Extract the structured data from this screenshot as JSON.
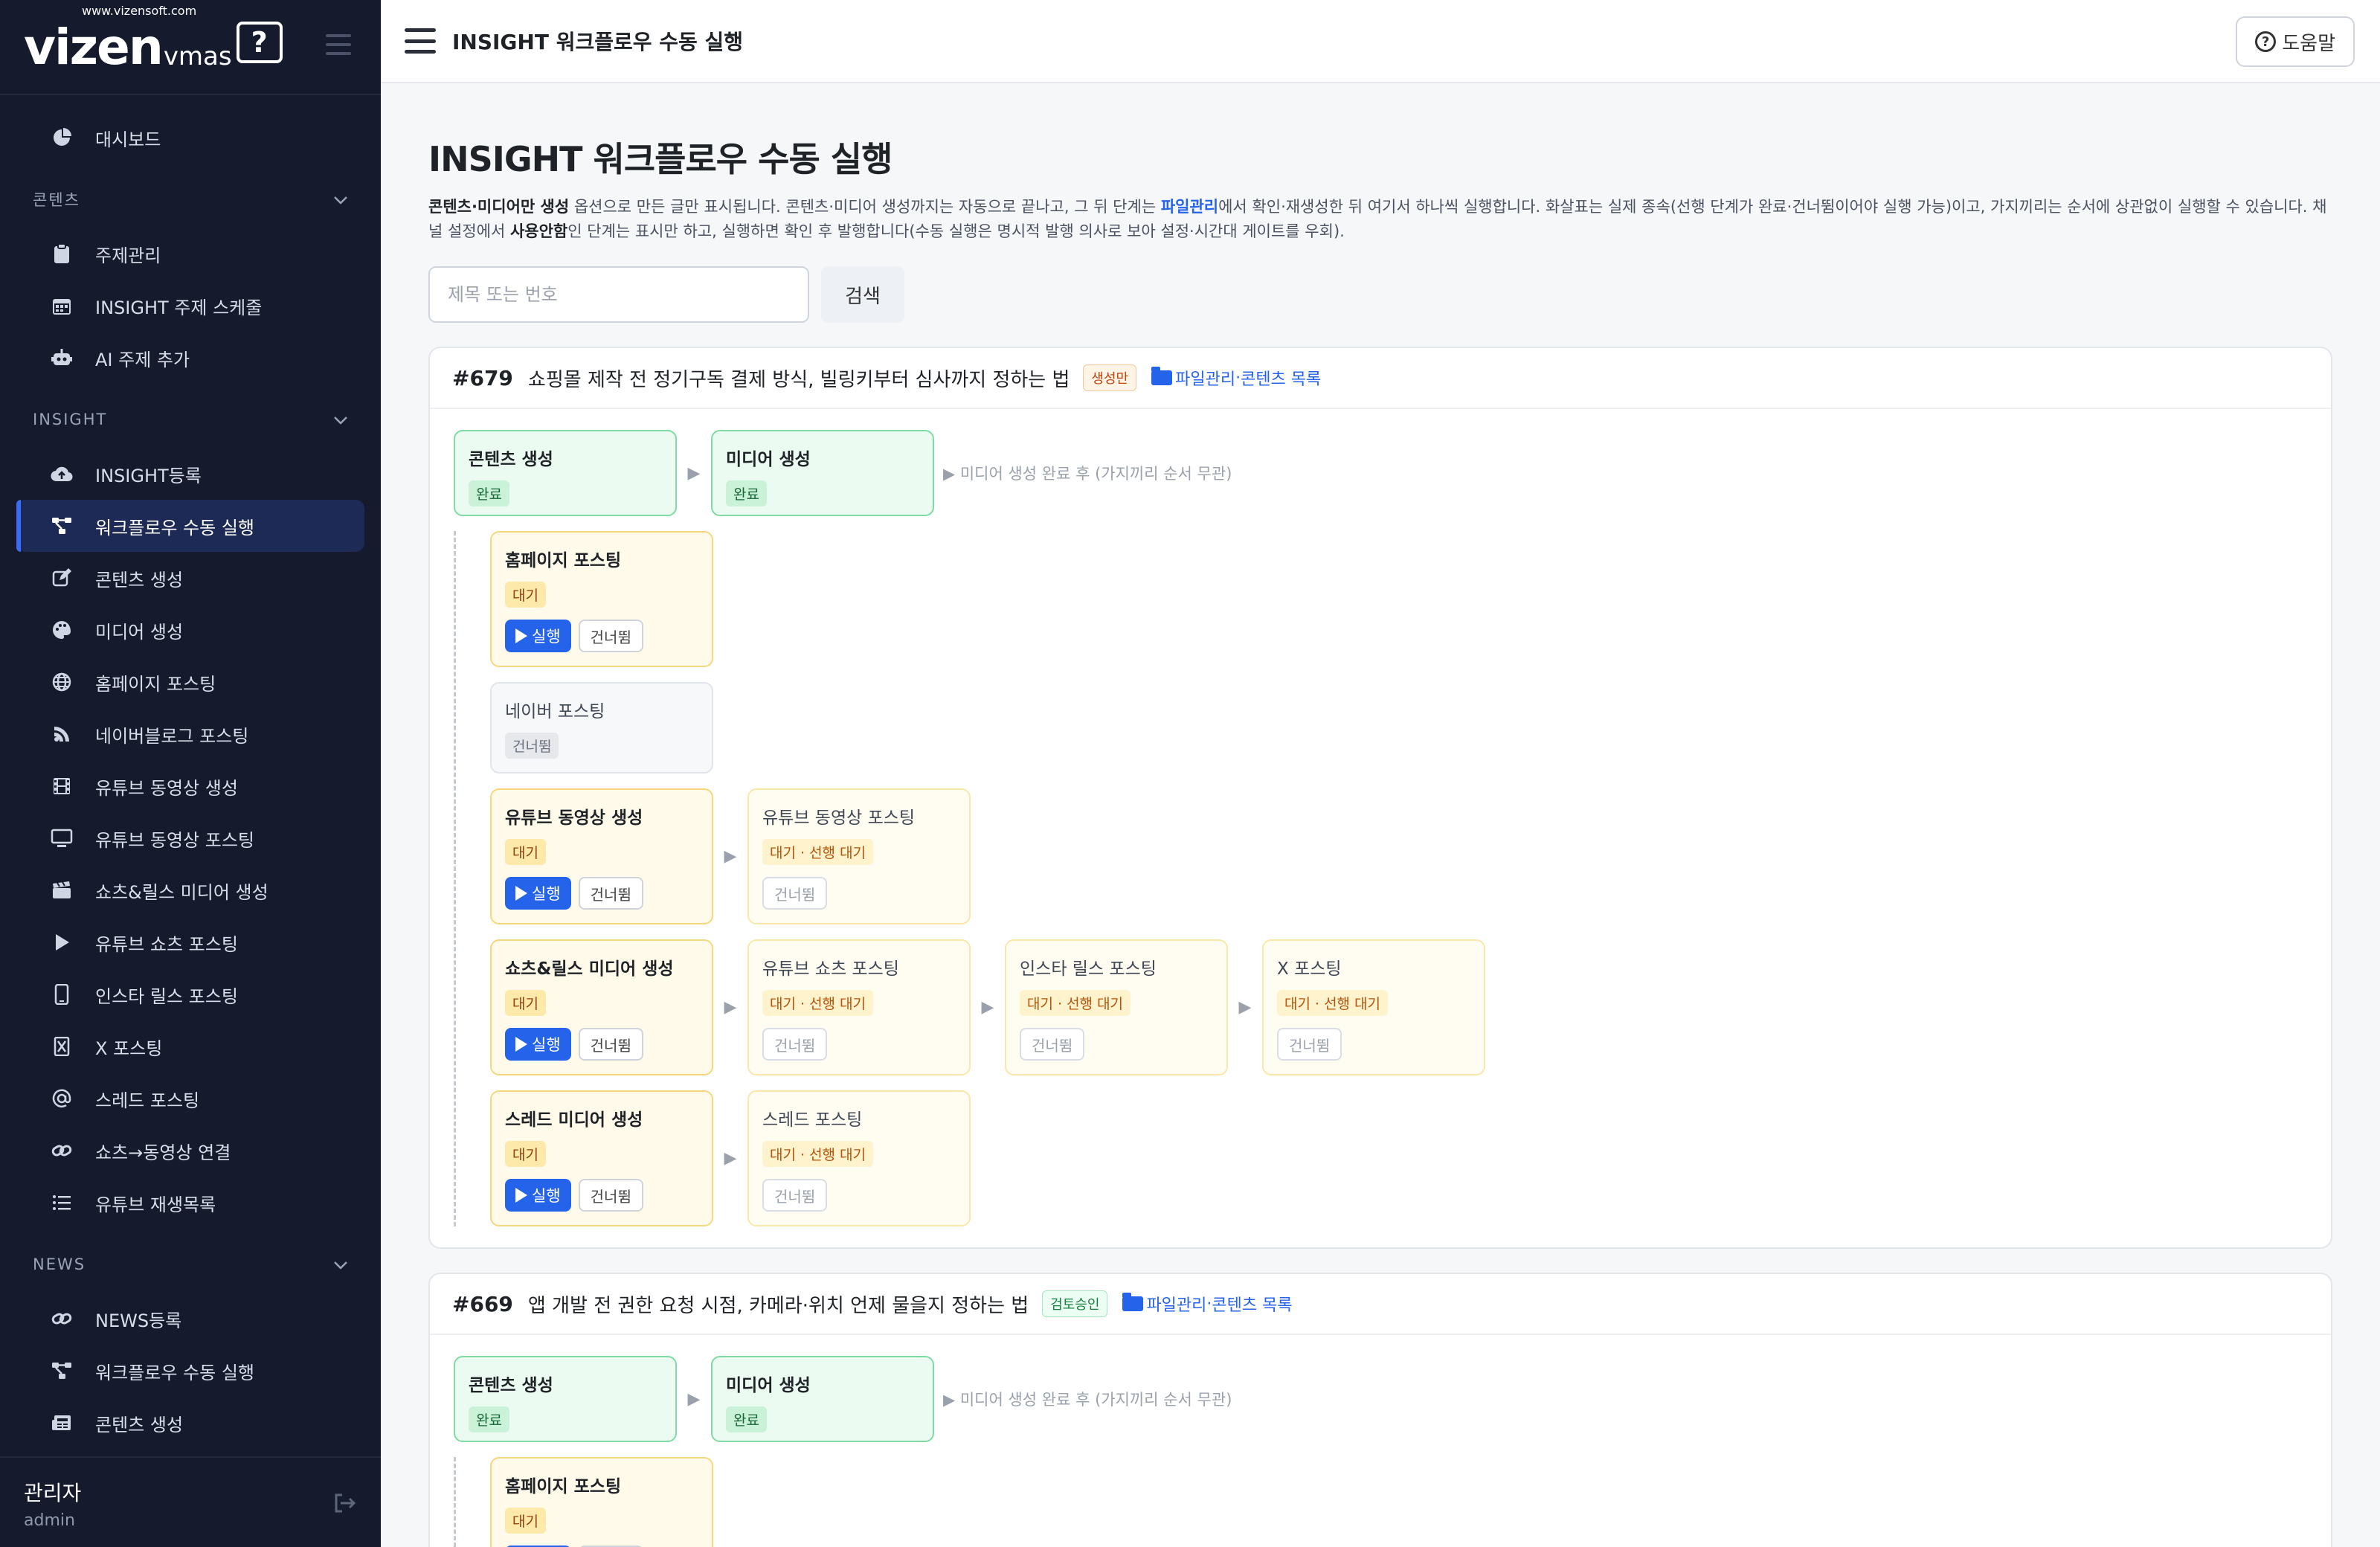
{
  "sidebar": {
    "logo_main": "vizen",
    "logo_sub": "vmas",
    "logo_url": "www.vizensoft.com",
    "logo_mark": "?",
    "top_items": [
      {
        "label": "대시보드",
        "icon": "pie-chart-icon"
      }
    ],
    "sections": [
      {
        "label": "콘텐츠",
        "items": [
          {
            "label": "주제관리",
            "icon": "clipboard-icon"
          },
          {
            "label": "INSIGHT 주제 스케줄",
            "icon": "calendar-icon"
          },
          {
            "label": "AI 주제 추가",
            "icon": "robot-icon"
          }
        ]
      },
      {
        "label": "INSIGHT",
        "items": [
          {
            "label": "INSIGHT등록",
            "icon": "cloud-upload-icon"
          },
          {
            "label": "워크플로우 수동 실행",
            "icon": "workflow-icon"
          },
          {
            "label": "콘텐츠 생성",
            "icon": "edit-icon"
          },
          {
            "label": "미디어 생성",
            "icon": "palette-icon"
          },
          {
            "label": "홈페이지 포스팅",
            "icon": "globe-icon"
          },
          {
            "label": "네이버블로그 포스팅",
            "icon": "blog-icon"
          },
          {
            "label": "유튜브 동영상 생성",
            "icon": "film-icon"
          },
          {
            "label": "유튜브 동영상 포스팅",
            "icon": "monitor-icon"
          },
          {
            "label": "쇼츠&릴스 미디어 생성",
            "icon": "clapper-icon"
          },
          {
            "label": "유튜브 쇼츠 포스팅",
            "icon": "play-icon"
          },
          {
            "label": "인스타 릴스 포스팅",
            "icon": "phone-icon"
          },
          {
            "label": "X 포스팅",
            "icon": "x-icon"
          },
          {
            "label": "스레드 포스팅",
            "icon": "at-icon"
          },
          {
            "label": "쇼츠→동영상 연결",
            "icon": "link-icon"
          },
          {
            "label": "유튜브 재생목록",
            "icon": "list-icon"
          }
        ]
      },
      {
        "label": "NEWS",
        "items": [
          {
            "label": "NEWS등록",
            "icon": "link-icon"
          },
          {
            "label": "워크플로우 수동 실행",
            "icon": "workflow-icon"
          },
          {
            "label": "콘텐츠 생성",
            "icon": "newspaper-icon"
          }
        ]
      }
    ],
    "user": {
      "name": "관리자",
      "role": "admin"
    }
  },
  "topbar": {
    "title": "INSIGHT 워크플로우 수동 실행",
    "help_label": "도움말"
  },
  "page": {
    "title": "INSIGHT 워크플로우 수동 실행",
    "desc_parts": [
      "콘텐츠·미디어만 생성",
      " 옵션으로 만든 글만 표시됩니다. 콘텐츠·미디어 생성까지는 자동으로 끝나고, 그 뒤 단계는 ",
      "파일관리",
      "에서 확인·재생성한 뒤 여기서 하나씩 실행합니다. 화살표는 실제 종속(선행 단계가 완료·건너뜀이어야 실행 가능)이고, 가지끼리는 순서에 상관없이 실행할 수 있습니다. 채널 설정에서 ",
      "사용안함",
      "인 단계는 표시만 하고, 실행하면 확인 후 발행합니다(수동 실행은 명시적 발행 의사로 보아 설정·시간대 게이트를 우회)."
    ],
    "search_placeholder": "제목 또는 번호",
    "search_button": "검색"
  },
  "labels": {
    "run": "실행",
    "skip": "건너뜀",
    "links_a": "파일관리",
    "links_sep": " · ",
    "links_b": "콘텐츠 목록",
    "arrow": "▶",
    "media_note": "▶ 미디어 생성 완료 후 (가지끼리 순서 무관)"
  },
  "cards": [
    {
      "num": "#679",
      "title": "쇼핑몰 제작 전 정기구독 결제 방식, 빌링키부터 심사까지 정하는 법",
      "badge": "생성만",
      "badge_color": "orange",
      "base": [
        {
          "title": "콘텐츠 생성",
          "status": "완료"
        },
        {
          "title": "미디어 생성",
          "status": "완료"
        }
      ],
      "branches": [
        [
          {
            "title": "홈페이지 포스팅",
            "status": "대기",
            "kind": "wait"
          }
        ],
        [
          {
            "title": "네이버 포스팅",
            "status": "건너뜀",
            "kind": "skipped"
          }
        ],
        [
          {
            "title": "유튜브 동영상 생성",
            "status": "대기",
            "kind": "wait"
          },
          {
            "title": "유튜브 동영상 포스팅",
            "status": "대기 · 선행 대기",
            "kind": "blocked"
          }
        ],
        [
          {
            "title": "쇼츠&릴스 미디어 생성",
            "status": "대기",
            "kind": "wait"
          },
          {
            "title": "유튜브 쇼츠 포스팅",
            "status": "대기 · 선행 대기",
            "kind": "blocked"
          },
          {
            "title": "인스타 릴스 포스팅",
            "status": "대기 · 선행 대기",
            "kind": "blocked"
          },
          {
            "title": "X 포스팅",
            "status": "대기 · 선행 대기",
            "kind": "blocked"
          }
        ],
        [
          {
            "title": "스레드 미디어 생성",
            "status": "대기",
            "kind": "wait"
          },
          {
            "title": "스레드 포스팅",
            "status": "대기 · 선행 대기",
            "kind": "blocked"
          }
        ]
      ]
    },
    {
      "num": "#669",
      "title": "앱 개발 전 권한 요청 시점, 카메라·위치 언제 물을지 정하는 법",
      "badge": "검토승인",
      "badge_color": "green",
      "base": [
        {
          "title": "콘텐츠 생성",
          "status": "완료"
        },
        {
          "title": "미디어 생성",
          "status": "완료"
        }
      ],
      "branches": [
        [
          {
            "title": "홈페이지 포스팅",
            "status": "대기",
            "kind": "wait"
          }
        ]
      ]
    }
  ]
}
